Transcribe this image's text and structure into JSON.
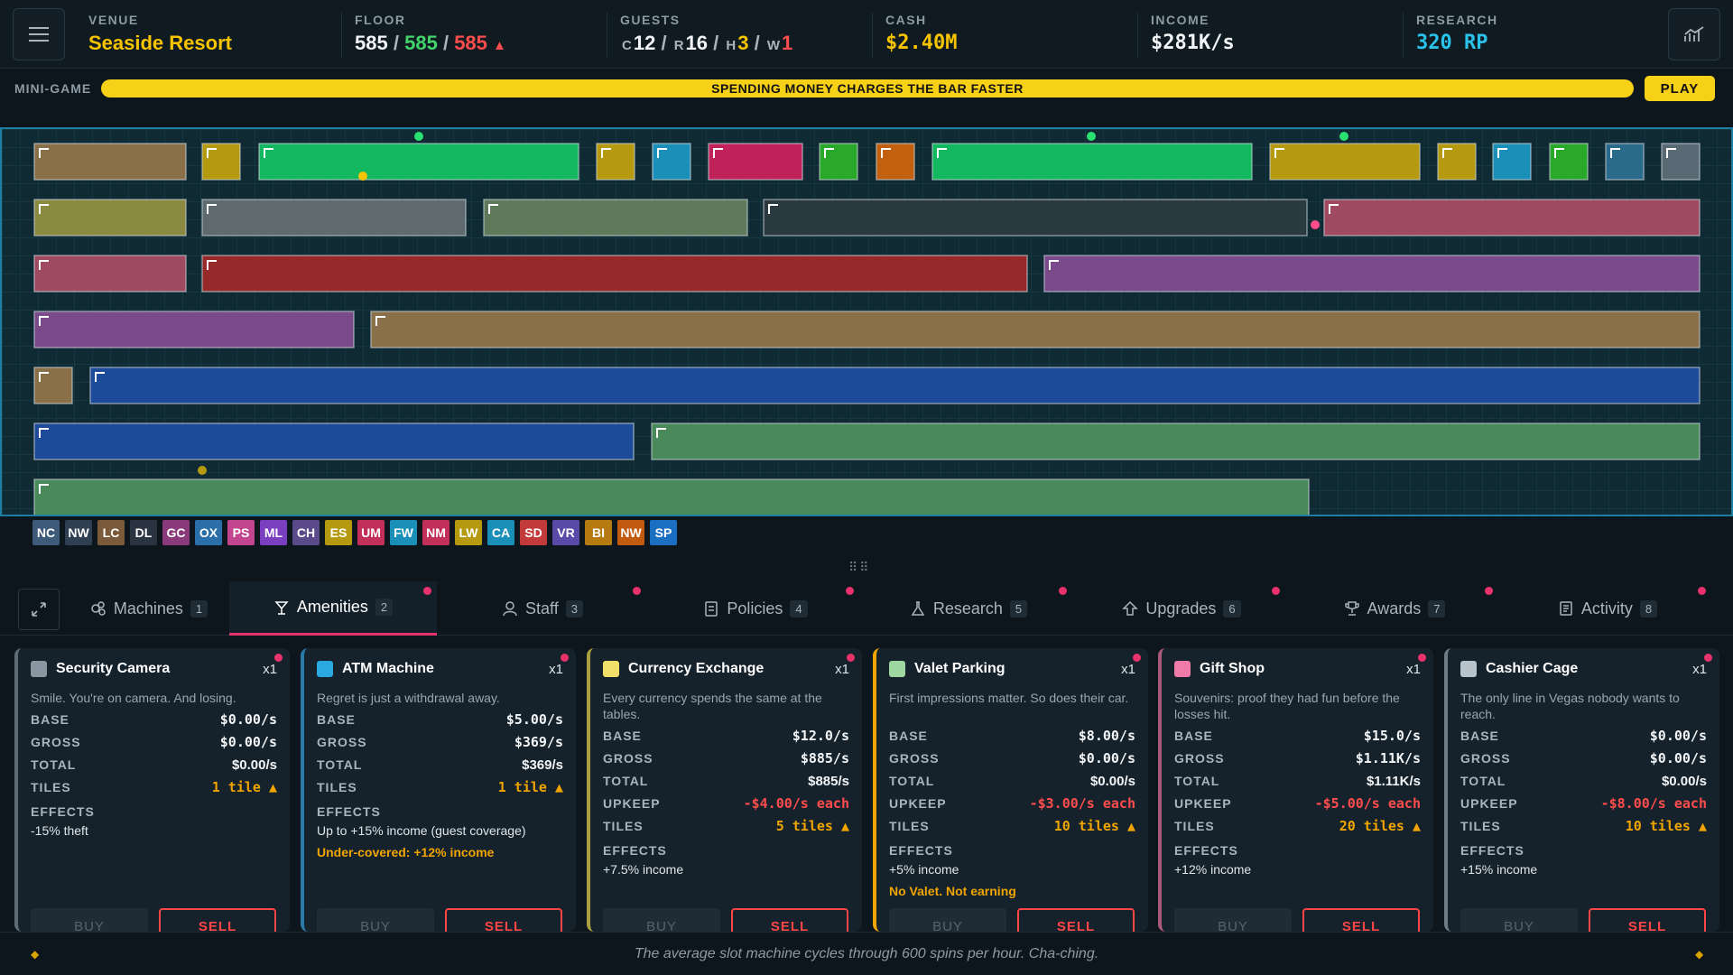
{
  "header": {
    "venue": {
      "label": "VENUE",
      "value": "Seaside Resort"
    },
    "floor": {
      "label": "FLOOR",
      "a": "585",
      "b": "585",
      "c": "585",
      "sep": "/",
      "arrow": "▲"
    },
    "guests": {
      "label": "GUESTS",
      "c_label": "C",
      "c": "12",
      "r_label": "R",
      "r": "16",
      "h_label": "H",
      "h": "3",
      "w_label": "W",
      "w": "1",
      "sep": "/"
    },
    "cash": {
      "label": "CASH",
      "value": "$2.40M"
    },
    "income": {
      "label": "INCOME",
      "value": "$281K/s"
    },
    "research": {
      "label": "RESEARCH",
      "value": "320 RP"
    }
  },
  "minigame": {
    "label": "MINI-GAME",
    "bar_text": "SPENDING MONEY CHARGES THE BAR FASTER",
    "play": "PLAY",
    "progress": 1.0
  },
  "floor_caps": [
    {
      "code": "NC",
      "color": "#3d5a7a"
    },
    {
      "code": "NW",
      "color": "#2f3f52"
    },
    {
      "code": "LC",
      "color": "#7a5a3a"
    },
    {
      "code": "DL",
      "color": "#2a3440"
    },
    {
      "code": "GC",
      "color": "#8a3a7a"
    },
    {
      "code": "OX",
      "color": "#2a6fa8"
    },
    {
      "code": "PS",
      "color": "#c2468e"
    },
    {
      "code": "ML",
      "color": "#7a3fc0"
    },
    {
      "code": "CH",
      "color": "#5a4a8a"
    },
    {
      "code": "ES",
      "color": "#b59a10"
    },
    {
      "code": "UM",
      "color": "#c2305a"
    },
    {
      "code": "FW",
      "color": "#1a8fb8"
    },
    {
      "code": "NM",
      "color": "#c2305a"
    },
    {
      "code": "LW",
      "color": "#b59a10"
    },
    {
      "code": "CA",
      "color": "#1a8fb8"
    },
    {
      "code": "SD",
      "color": "#c23a3a"
    },
    {
      "code": "VR",
      "color": "#5a4aa8"
    },
    {
      "code": "BI",
      "color": "#b57a10"
    },
    {
      "code": "NW",
      "color": "#c25a10"
    },
    {
      "code": "SP",
      "color": "#1a6fc2"
    }
  ],
  "tabs": [
    {
      "label": "Machines",
      "count": "1",
      "icon": "machines-icon"
    },
    {
      "label": "Amenities",
      "count": "2",
      "icon": "amenities-icon",
      "active": true
    },
    {
      "label": "Staff",
      "count": "3",
      "icon": "staff-icon"
    },
    {
      "label": "Policies",
      "count": "4",
      "icon": "policies-icon"
    },
    {
      "label": "Research",
      "count": "5",
      "icon": "research-icon"
    },
    {
      "label": "Upgrades",
      "count": "6",
      "icon": "upgrades-icon"
    },
    {
      "label": "Awards",
      "count": "7",
      "icon": "awards-icon"
    },
    {
      "label": "Activity",
      "count": "8",
      "icon": "activity-icon"
    }
  ],
  "cards": [
    {
      "title": "Security Camera",
      "qty": "x1",
      "color": "#8a97a3",
      "border": "#5e6b75",
      "desc": "Smile. You're on camera. And losing.",
      "rows": [
        [
          "BASE",
          "$0.00/s"
        ],
        [
          "GROSS",
          "$0.00/s"
        ],
        [
          "TOTAL",
          "$0.00/s"
        ],
        [
          "TILES",
          "1 tile ▲"
        ]
      ],
      "effects_label": "EFFECTS",
      "effects": "-15% theft",
      "warn": "",
      "buy": "BUY",
      "sell": "SELL"
    },
    {
      "title": "ATM Machine",
      "qty": "x1",
      "color": "#2aa8e0",
      "border": "#2a7aa8",
      "desc": "Regret is just a withdrawal away.",
      "rows": [
        [
          "BASE",
          "$5.00/s"
        ],
        [
          "GROSS",
          "$369/s"
        ],
        [
          "TOTAL",
          "$369/s"
        ],
        [
          "TILES",
          "1 tile ▲"
        ]
      ],
      "effects_label": "EFFECTS",
      "effects": "Up to +15% income (guest coverage)",
      "warn": "Under-covered: +12% income",
      "buy": "BUY",
      "sell": "SELL"
    },
    {
      "title": "Currency Exchange",
      "qty": "x1",
      "color": "#f0e06a",
      "border": "#a8a040",
      "desc": "Every currency spends the same at the tables.",
      "rows": [
        [
          "BASE",
          "$12.0/s"
        ],
        [
          "GROSS",
          "$885/s"
        ],
        [
          "TOTAL",
          "$885/s"
        ],
        [
          "UPKEEP",
          "-$4.00/s each"
        ],
        [
          "TILES",
          "5 tiles ▲"
        ]
      ],
      "effects_label": "EFFECTS",
      "effects": "+7.5% income",
      "warn": "",
      "buy": "BUY",
      "sell": "SELL"
    },
    {
      "title": "Valet Parking",
      "qty": "x1",
      "color": "#9ed8a0",
      "border": "#f0a500",
      "desc": "First impressions matter. So does their car.",
      "rows": [
        [
          "BASE",
          "$8.00/s"
        ],
        [
          "GROSS",
          "$0.00/s"
        ],
        [
          "TOTAL",
          "$0.00/s"
        ],
        [
          "UPKEEP",
          "-$3.00/s each"
        ],
        [
          "TILES",
          "10 tiles ▲"
        ]
      ],
      "effects_label": "EFFECTS",
      "effects": "+5% income",
      "warn": "No Valet. Not earning",
      "buy": "BUY",
      "sell": "SELL"
    },
    {
      "title": "Gift Shop",
      "qty": "x1",
      "color": "#f07aa8",
      "border": "#a85a7a",
      "desc": "Souvenirs: proof they had fun before the losses hit.",
      "rows": [
        [
          "BASE",
          "$15.0/s"
        ],
        [
          "GROSS",
          "$1.11K/s"
        ],
        [
          "TOTAL",
          "$1.11K/s"
        ],
        [
          "UPKEEP",
          "-$5.00/s each"
        ],
        [
          "TILES",
          "20 tiles ▲"
        ]
      ],
      "effects_label": "EFFECTS",
      "effects": "+12% income",
      "warn": "",
      "buy": "BUY",
      "sell": "SELL"
    },
    {
      "title": "Cashier Cage",
      "qty": "x1",
      "color": "#b8c2ca",
      "border": "#6e7a84",
      "desc": "The only line in Vegas nobody wants to reach.",
      "rows": [
        [
          "BASE",
          "$0.00/s"
        ],
        [
          "GROSS",
          "$0.00/s"
        ],
        [
          "TOTAL",
          "$0.00/s"
        ],
        [
          "UPKEEP",
          "-$8.00/s each"
        ],
        [
          "TILES",
          "10 tiles ▲"
        ]
      ],
      "effects_label": "EFFECTS",
      "effects": "+15% income",
      "warn": "",
      "buy": "BUY",
      "sell": "SELL"
    }
  ],
  "footer": {
    "tip": "The average slot machine cycles through 600 spins per hour. Cha-ching."
  }
}
